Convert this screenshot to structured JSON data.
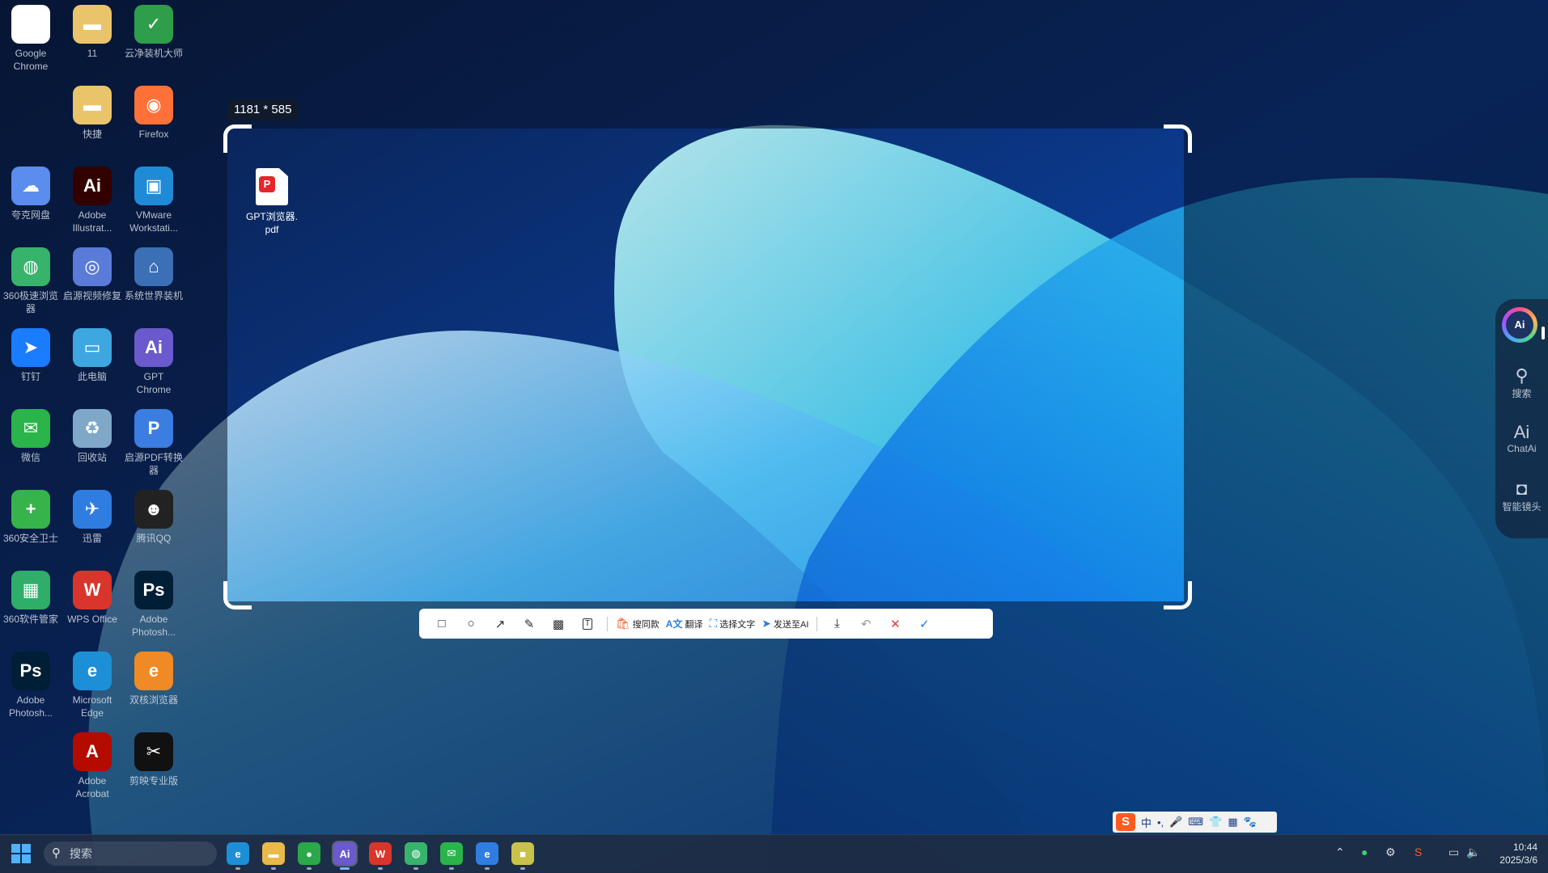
{
  "desktop": {
    "icons": [
      {
        "label": "Google\nChrome",
        "glyph": "●",
        "color": "#ffffff"
      },
      {
        "label": "11",
        "glyph": "▬",
        "color": "#e9c46a"
      },
      {
        "label": "云净装机大师",
        "glyph": "✓",
        "color": "#2e9e4a"
      },
      {
        "label": "快捷",
        "glyph": "▬",
        "color": "#e9c46a"
      },
      {
        "label": "Firefox",
        "glyph": "◉",
        "color": "#ff7139"
      },
      {
        "label": "夸克网盘",
        "glyph": "☁",
        "color": "#5b8def"
      },
      {
        "label": "Adobe\nIllustrat...",
        "glyph": "Ai",
        "color": "#330000"
      },
      {
        "label": "VMware\nWorkstati...",
        "glyph": "▣",
        "color": "#1f8bd6"
      },
      {
        "label": "360极速浏览\n器",
        "glyph": "◍",
        "color": "#38b36c"
      },
      {
        "label": "启源视频修复",
        "glyph": "◎",
        "color": "#5a7bd8"
      },
      {
        "label": "系统世界装机",
        "glyph": "⌂",
        "color": "#3b6fb6"
      },
      {
        "label": "钉钉",
        "glyph": "➤",
        "color": "#1a7cff"
      },
      {
        "label": "此电脑",
        "glyph": "▭",
        "color": "#3ea7e0"
      },
      {
        "label": "GPT\nChrome",
        "glyph": "Ai",
        "color": "#6a5acd"
      },
      {
        "label": "微信",
        "glyph": "✉",
        "color": "#2ab44a"
      },
      {
        "label": "回收站",
        "glyph": "♻",
        "color": "#7fa7c7"
      },
      {
        "label": "启源PDF转换\n器",
        "glyph": "P",
        "color": "#3b7de0"
      },
      {
        "label": "360安全卫士",
        "glyph": "+",
        "color": "#36b34a"
      },
      {
        "label": "迅雷",
        "glyph": "✈",
        "color": "#2f7de1"
      },
      {
        "label": "腾讯QQ",
        "glyph": "☻",
        "color": "#222222"
      },
      {
        "label": "360软件管家",
        "glyph": "▦",
        "color": "#2fae6a"
      },
      {
        "label": "WPS Office",
        "glyph": "W",
        "color": "#d9352c"
      },
      {
        "label": "Adobe\nPhotosh...",
        "glyph": "Ps",
        "color": "#001e36"
      },
      {
        "label": "Adobe\nPhotosh...",
        "glyph": "Ps",
        "color": "#001e36"
      },
      {
        "label": "Microsoft\nEdge",
        "glyph": "e",
        "color": "#1d8fd6"
      },
      {
        "label": "双核浏览器",
        "glyph": "e",
        "color": "#f08a24"
      },
      {
        "label": "Adobe\nAcrobat",
        "glyph": "A",
        "color": "#b30b00"
      },
      {
        "label": "剪映专业版",
        "glyph": "✂",
        "color": "#111111"
      }
    ],
    "file_in_selection": "GPT浏览器.\npdf"
  },
  "screenshot": {
    "size_label": "1181 * 585"
  },
  "toolbar": {
    "tools": [
      {
        "name": "rect",
        "glyph": "□"
      },
      {
        "name": "ellipse",
        "glyph": "○"
      },
      {
        "name": "arrow",
        "glyph": "↗"
      },
      {
        "name": "pen",
        "glyph": "✎"
      },
      {
        "name": "mosaic",
        "glyph": "▩"
      },
      {
        "name": "text",
        "glyph": "T"
      }
    ],
    "search_same": "搜同款",
    "translate": "翻译",
    "select_text": "选择文字",
    "send_ai": "发送至AI",
    "download_glyph": "⤓",
    "undo_glyph": "↶",
    "cancel_glyph": "✕",
    "confirm_glyph": "✓"
  },
  "sidebar": {
    "ai_label": "Ai",
    "items": [
      {
        "label": "搜索",
        "glyph": "⚲"
      },
      {
        "label": "ChatAi",
        "glyph": "Ai"
      },
      {
        "label": "智能镜头",
        "glyph": "◘"
      }
    ]
  },
  "ime": {
    "logo": "S",
    "items": [
      "中",
      "•,",
      "🎤",
      "⌨",
      "👕",
      "▦",
      "🐾"
    ]
  },
  "taskbar": {
    "search_placeholder": "搜索",
    "time": "10:44",
    "date": "2025/3/6"
  }
}
